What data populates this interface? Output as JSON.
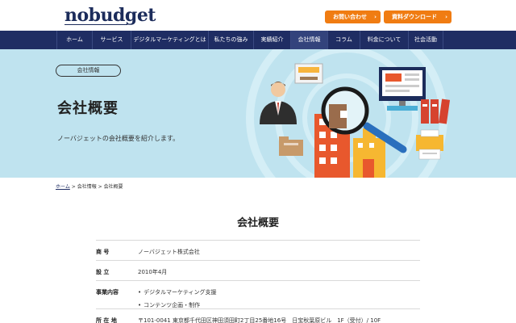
{
  "header": {
    "logo": "nobudget",
    "cta_contact": "お問い合わせ",
    "cta_download": "資料ダウンロード",
    "chevron": "›"
  },
  "nav": {
    "items": [
      {
        "label": "ホーム"
      },
      {
        "label": "サービス"
      },
      {
        "label": "デジタルマーケティングとは"
      },
      {
        "label": "私たちの強み"
      },
      {
        "label": "実績紹介"
      },
      {
        "label": "会社情報"
      },
      {
        "label": "コラム"
      },
      {
        "label": "料金について"
      },
      {
        "label": "社会活動"
      }
    ],
    "active": "会社情報"
  },
  "hero": {
    "badge": "会社情報",
    "title": "会社概要",
    "description": "ノーバジェットの会社概要を紹介します。",
    "icons": [
      "businessman-icon",
      "file-drawer-icon",
      "magnifying-glass-icon",
      "building-icon",
      "computer-monitor-icon",
      "binders-icon",
      "printer-icon",
      "folder-icon"
    ]
  },
  "breadcrumb": {
    "home": "ホーム",
    "separator": ">",
    "parent": "会社情報",
    "current": "会社概要"
  },
  "main": {
    "title": "会社概要",
    "rows": [
      {
        "label": "商 号",
        "value": "ノーバジェット株式会社"
      },
      {
        "label": "設 立",
        "value": "2010年4月"
      },
      {
        "label": "事業内容",
        "items": [
          "デジタルマーケティング支援",
          "コンテンツ企画・制作"
        ]
      },
      {
        "label": "所 在 地",
        "value": "〒101-0041 東京都千代田区神田須田町2丁目25番地16号　日宝秋葉原ビル　1F（受付）/ 10F"
      }
    ]
  },
  "colors": {
    "navy": "#1f2d63",
    "orange": "#f07c12",
    "hero_bg": "#bfe3ef"
  }
}
